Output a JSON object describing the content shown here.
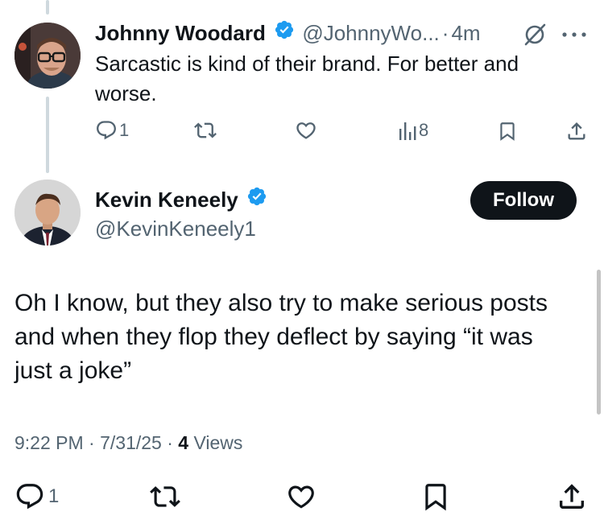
{
  "reply": {
    "display_name": "Johnny Woodard",
    "handle": "@JohnnyWo...",
    "separator": "·",
    "time": "4m",
    "text_line1": "Sarcastic is kind of their brand. For better and",
    "text_line2": "worse.",
    "reply_count": "1",
    "views_count": "8"
  },
  "main": {
    "display_name": "Kevin Keneely",
    "handle": "@KevinKeneely1",
    "follow_label": "Follow",
    "text_line1": "Oh I know, but they also try to make serious posts",
    "text_line2": "and when they flop they deflect by saying “it was",
    "text_line3": "just a joke”",
    "timestamp": "9:22 PM · 7/31/25 · ",
    "views_number": "4",
    "views_label": "Views",
    "reply_count": "1"
  },
  "colors": {
    "verified": "#1d9bf0",
    "text": "#0f1419",
    "muted": "#536471",
    "thread_line": "#cfd9de"
  },
  "icons": [
    "verified-badge-icon",
    "grok-icon",
    "more-icon",
    "reply-icon",
    "retweet-icon",
    "like-icon",
    "views-icon",
    "bookmark-icon",
    "share-icon"
  ]
}
